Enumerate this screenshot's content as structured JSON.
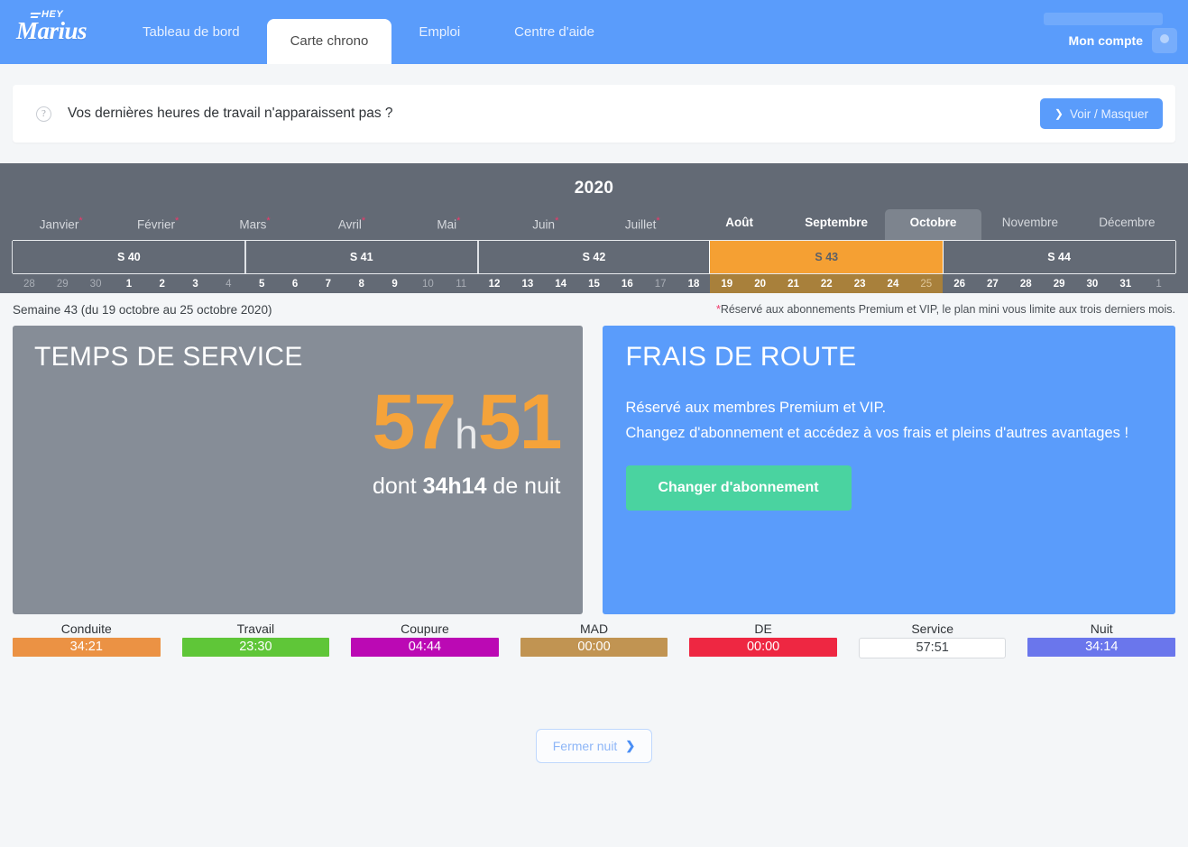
{
  "navbar": {
    "brand_hey": "HEY",
    "brand_name": "Marius",
    "tabs": [
      {
        "label": "Tableau de bord",
        "active": false
      },
      {
        "label": "Carte chrono",
        "active": true
      },
      {
        "label": "Emploi",
        "active": false
      },
      {
        "label": "Centre d'aide",
        "active": false
      }
    ],
    "account_label": "Mon compte"
  },
  "alert": {
    "icon": "question-circle-icon",
    "text": "Vos dernières heures de travail n'apparaissent pas ?",
    "button_label": "Voir / Masquer",
    "button_icon": "chevron-down-icon",
    "button_color": "#5a9cfb"
  },
  "calendar": {
    "year": "2020",
    "months": [
      {
        "label": "Janvier",
        "asterisk": true,
        "state": "dim"
      },
      {
        "label": "Février",
        "asterisk": true,
        "state": "dim"
      },
      {
        "label": "Mars",
        "asterisk": true,
        "state": "dim"
      },
      {
        "label": "Avril",
        "asterisk": true,
        "state": "dim"
      },
      {
        "label": "Mai",
        "asterisk": true,
        "state": "dim"
      },
      {
        "label": "Juin",
        "asterisk": true,
        "state": "dim"
      },
      {
        "label": "Juillet",
        "asterisk": true,
        "state": "dim"
      },
      {
        "label": "Août",
        "asterisk": false,
        "state": "bold"
      },
      {
        "label": "Septembre",
        "asterisk": false,
        "state": "bold"
      },
      {
        "label": "Octobre",
        "asterisk": false,
        "state": "selected"
      },
      {
        "label": "Novembre",
        "asterisk": false,
        "state": "dim"
      },
      {
        "label": "Décembre",
        "asterisk": false,
        "state": "dim"
      }
    ],
    "weeks": [
      {
        "label": "S 40",
        "span": 7,
        "selected": false
      },
      {
        "label": "S 41",
        "span": 7,
        "selected": false
      },
      {
        "label": "S 42",
        "span": 7,
        "selected": false
      },
      {
        "label": "S 43",
        "span": 7,
        "selected": true
      },
      {
        "label": "S 44",
        "span": 7,
        "selected": false
      }
    ],
    "selected_week_color": "#f5a033",
    "days": [
      {
        "n": "28",
        "dim": true,
        "inweek": false
      },
      {
        "n": "29",
        "dim": true,
        "inweek": false
      },
      {
        "n": "30",
        "dim": true,
        "inweek": false
      },
      {
        "n": "1",
        "dim": false,
        "inweek": false
      },
      {
        "n": "2",
        "dim": false,
        "inweek": false
      },
      {
        "n": "3",
        "dim": false,
        "inweek": false
      },
      {
        "n": "4",
        "dim": true,
        "inweek": false
      },
      {
        "n": "5",
        "dim": false,
        "inweek": false
      },
      {
        "n": "6",
        "dim": false,
        "inweek": false
      },
      {
        "n": "7",
        "dim": false,
        "inweek": false
      },
      {
        "n": "8",
        "dim": false,
        "inweek": false
      },
      {
        "n": "9",
        "dim": false,
        "inweek": false
      },
      {
        "n": "10",
        "dim": true,
        "inweek": false
      },
      {
        "n": "11",
        "dim": true,
        "inweek": false
      },
      {
        "n": "12",
        "dim": false,
        "inweek": false
      },
      {
        "n": "13",
        "dim": false,
        "inweek": false
      },
      {
        "n": "14",
        "dim": false,
        "inweek": false
      },
      {
        "n": "15",
        "dim": false,
        "inweek": false
      },
      {
        "n": "16",
        "dim": false,
        "inweek": false
      },
      {
        "n": "17",
        "dim": true,
        "inweek": false
      },
      {
        "n": "18",
        "dim": false,
        "inweek": false
      },
      {
        "n": "19",
        "dim": false,
        "inweek": true
      },
      {
        "n": "20",
        "dim": false,
        "inweek": true
      },
      {
        "n": "21",
        "dim": false,
        "inweek": true
      },
      {
        "n": "22",
        "dim": false,
        "inweek": true
      },
      {
        "n": "23",
        "dim": false,
        "inweek": true
      },
      {
        "n": "24",
        "dim": false,
        "inweek": true
      },
      {
        "n": "25",
        "dim": true,
        "inweek": true
      },
      {
        "n": "26",
        "dim": false,
        "inweek": false
      },
      {
        "n": "27",
        "dim": false,
        "inweek": false
      },
      {
        "n": "28",
        "dim": false,
        "inweek": false
      },
      {
        "n": "29",
        "dim": false,
        "inweek": false
      },
      {
        "n": "30",
        "dim": false,
        "inweek": false
      },
      {
        "n": "31",
        "dim": false,
        "inweek": false
      },
      {
        "n": "1",
        "dim": true,
        "inweek": false
      }
    ]
  },
  "subrow": {
    "semaine": "Semaine 43 (du 19 octobre au 25 octobre 2020)",
    "note_asterisk": "*",
    "note": "Réservé aux abonnements Premium et VIP, le plan mini vous limite aux trois derniers mois."
  },
  "service_panel": {
    "title": "TEMPS DE SERVICE",
    "hours": "57",
    "h_separator": "h",
    "minutes": "51",
    "night_prefix": "dont ",
    "night_value": "34h14",
    "night_suffix": " de nuit",
    "accent_color": "#f5a33a",
    "bg_color": "#868d97"
  },
  "frais_panel": {
    "title": "FRAIS DE ROUTE",
    "line1": "Réservé aux membres Premium et VIP.",
    "line2": "Changez d'abonnement et accédez à vos frais et pleins d'autres avantages !",
    "button_label": "Changer d'abonnement",
    "button_color": "#4ad3a0",
    "bg_color": "#5a9cfb"
  },
  "stats": [
    {
      "label": "Conduite",
      "value": "34:21",
      "color": "#eb9244",
      "text_color": "#ffffff"
    },
    {
      "label": "Travail",
      "value": "23:30",
      "color": "#5fc638",
      "text_color": "#ffffff"
    },
    {
      "label": "Coupure",
      "value": "04:44",
      "color": "#bb09b4",
      "text_color": "#ffffff"
    },
    {
      "label": "MAD",
      "value": "00:00",
      "color": "#c19452",
      "text_color": "#ffffff"
    },
    {
      "label": "DE",
      "value": "00:00",
      "color": "#ee2742",
      "text_color": "#ffffff"
    },
    {
      "label": "Service",
      "value": "57:51",
      "color": "#ffffff",
      "text_color": "#3d4348"
    },
    {
      "label": "Nuit",
      "value": "34:14",
      "color": "#6a76ec",
      "text_color": "#ffffff"
    }
  ],
  "footer": {
    "button_label": "Fermer nuit",
    "button_icon": "chevron-down-icon"
  }
}
